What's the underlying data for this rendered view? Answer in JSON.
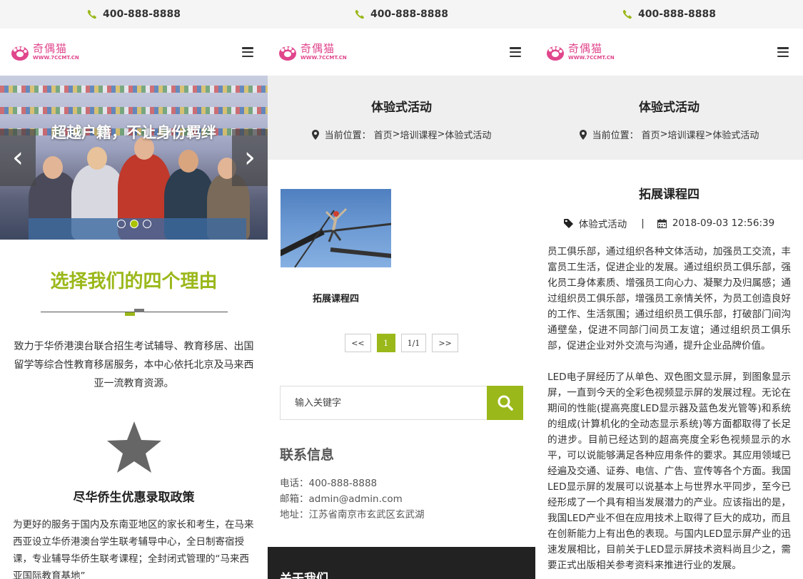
{
  "phone": "400-888-8888",
  "logo": {
    "name": "奇偶猫",
    "url": "WWW.7CCMT.CN"
  },
  "panel1": {
    "banner": {
      "title": "超越户籍，不让身份羁绊",
      "prev": "‹",
      "next": "›"
    },
    "section_title": "选择我们的四个理由",
    "intro": "致力于华侨港澳台联合招生考试辅导、教育移居、出国留学等综合性教育移居服务，本中心依托北京及马来西亚一流教育资源。",
    "feature_title": "尽华侨生优惠录取政策",
    "feature_text": "为更好的服务于国内及东南亚地区的家长和考生，在马来西亚设立华侨港澳台学生联考辅导中心，全日制寄宿授课，专业辅导华侨生联考课程；全封闭式管理的“马来西亚国际教育基地”"
  },
  "panel2": {
    "page_title": "体验式活动",
    "crumb_label": "当前位置：",
    "crumb_home": "首页",
    "crumb_sep": ">",
    "crumb_cat": "培训课程",
    "crumb_cur": "体验式活动",
    "course": "拓展课程四",
    "pager": {
      "prev": "<<",
      "current": "1",
      "total": "1/1",
      "next": ">>"
    },
    "search_placeholder": "输入关键字",
    "contact_title": "联系信息",
    "contact": {
      "phone": "电话：400-888-8888",
      "email": "邮箱：admin@admin.com",
      "address": "地址：江苏省南京市玄武区玄武湖"
    },
    "about_title": "关于我们"
  },
  "panel3": {
    "page_title": "体验式活动",
    "crumb_label": "当前位置：",
    "crumb_home": "首页",
    "crumb_sep": ">",
    "crumb_cat": "培训课程",
    "crumb_cur": "体验式活动",
    "article_title": "拓展课程四",
    "category": "体验式活动",
    "separator": "|",
    "date": "2018-09-03 12:56:39",
    "para1": "员工俱乐部，通过组织各种文体活动，加强员工交流，丰富员工生活，促进企业的发展。通过组织员工俱乐部，强化员工身体素质、增强员工向心力、凝聚力及归属感；通过组织员工俱乐部，增强员工亲情关怀，为员工创造良好的工作、生活氛围；通过组织员工俱乐部，打破部门间沟通壁垒，促进不同部门间员工友谊；通过组织员工俱乐部，促进企业对外交流与沟通，提升企业品牌价值。",
    "para2": "LED电子屏经历了从单色、双色图文显示屏，到图象显示屏，一直到今天的全彩色视频显示屏的发展过程。无论在期间的性能(提高亮度LED显示器及蓝色发光管等)和系统的组成(计算机化的全动态显示系统)等方面都取得了长足的进步。目前已经达到的超高亮度全彩色视频显示的水平，可以说能够满足各种应用条件的要求。其应用领域已经遍及交通、证券、电信、广告、宣传等各个方面。我国LED显示屏的发展可以说基本上与世界水平同步，至今已经形成了一个具有相当发展潜力的产业。应该指出的是，我国LED产业不但在应用技术上取得了巨大的成功，而且在创新能力上有出色的表现。与国内LED显示屏产业的迅速发展相比，目前关于LED显示屏技术资料尚且少之，需要正式出版相关参考资料来推进行业的发展。"
  },
  "colors": {
    "accent": "#9ab81a",
    "logo": "#e0468c",
    "dark_footer": "#222222"
  }
}
